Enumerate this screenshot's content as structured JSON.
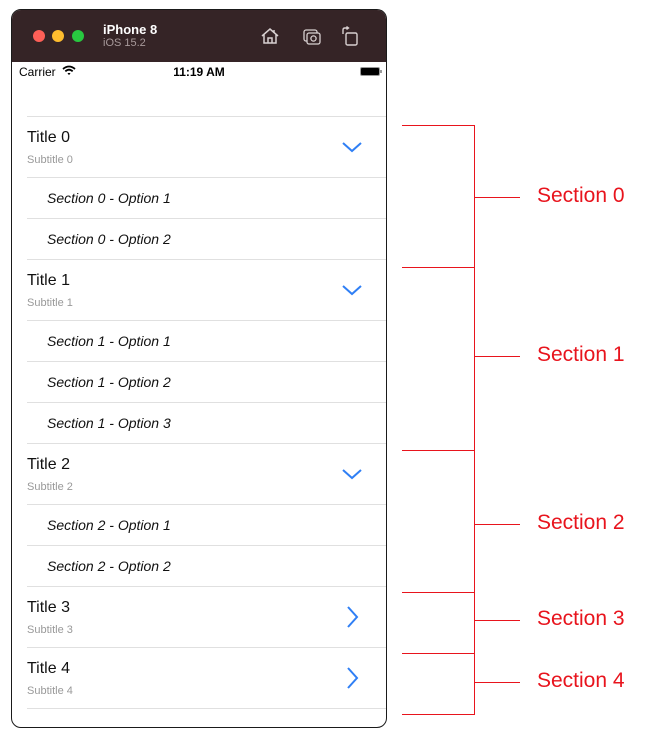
{
  "simulator": {
    "device_name": "iPhone 8",
    "os_version": "iOS 15.2",
    "toolbar_icons": [
      "home-icon",
      "screenshot-icon",
      "rotate-icon"
    ]
  },
  "status_bar": {
    "carrier": "Carrier",
    "time": "11:19 AM"
  },
  "sections": [
    {
      "title": "Title 0",
      "subtitle": "Subtitle 0",
      "expanded": true,
      "options": [
        "Section 0 - Option 1",
        "Section 0 - Option 2"
      ]
    },
    {
      "title": "Title 1",
      "subtitle": "Subtitle 1",
      "expanded": true,
      "options": [
        "Section 1 - Option 1",
        "Section 1 - Option 2",
        "Section 1 - Option 3"
      ]
    },
    {
      "title": "Title 2",
      "subtitle": "Subtitle 2",
      "expanded": true,
      "options": [
        "Section 2 - Option 1",
        "Section 2 - Option 2"
      ]
    },
    {
      "title": "Title 3",
      "subtitle": "Subtitle 3",
      "expanded": false,
      "options": []
    },
    {
      "title": "Title 4",
      "subtitle": "Subtitle 4",
      "expanded": false,
      "options": []
    }
  ],
  "annotations": [
    "Section 0",
    "Section 1",
    "Section 2",
    "Section 3",
    "Section 4"
  ],
  "colors": {
    "accent": "#2f7ff5",
    "annotation": "#e8141d",
    "titlebar": "#352426"
  }
}
